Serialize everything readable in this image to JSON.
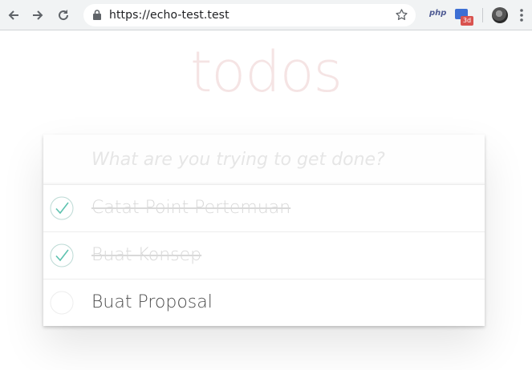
{
  "browser": {
    "url": "https://echo-test.test",
    "extensions": {
      "php_label": "php",
      "badge_3d": "3d"
    }
  },
  "app": {
    "title": "todos",
    "new_todo_placeholder": "What are you trying to get done?",
    "todos": [
      {
        "label": "Catat Point Pertemuan",
        "completed": true
      },
      {
        "label": "Buat Konsep",
        "completed": true
      },
      {
        "label": "Buat Proposal",
        "completed": false
      }
    ]
  },
  "colors": {
    "check": "#5dc2af",
    "title": "#af2f2f",
    "toolbar": "#f1f3f4"
  }
}
